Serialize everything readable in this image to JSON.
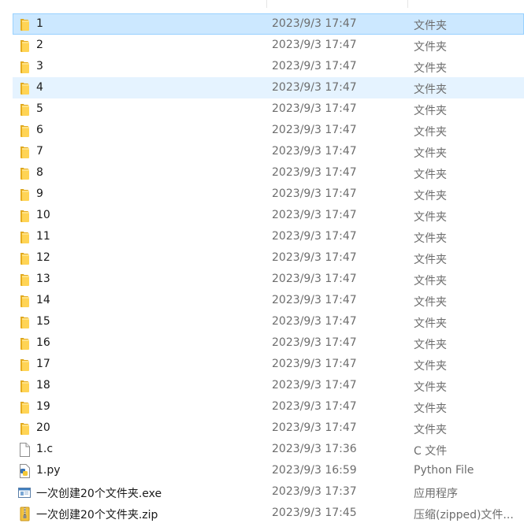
{
  "files": [
    {
      "name": "1",
      "date": "2023/9/3 17:47",
      "type": "文件夹",
      "icon": "folder-icon",
      "state": "selected"
    },
    {
      "name": "2",
      "date": "2023/9/3 17:47",
      "type": "文件夹",
      "icon": "folder-icon",
      "state": ""
    },
    {
      "name": "3",
      "date": "2023/9/3 17:47",
      "type": "文件夹",
      "icon": "folder-icon",
      "state": ""
    },
    {
      "name": "4",
      "date": "2023/9/3 17:47",
      "type": "文件夹",
      "icon": "folder-icon",
      "state": "hover"
    },
    {
      "name": "5",
      "date": "2023/9/3 17:47",
      "type": "文件夹",
      "icon": "folder-icon",
      "state": ""
    },
    {
      "name": "6",
      "date": "2023/9/3 17:47",
      "type": "文件夹",
      "icon": "folder-icon",
      "state": ""
    },
    {
      "name": "7",
      "date": "2023/9/3 17:47",
      "type": "文件夹",
      "icon": "folder-icon",
      "state": ""
    },
    {
      "name": "8",
      "date": "2023/9/3 17:47",
      "type": "文件夹",
      "icon": "folder-icon",
      "state": ""
    },
    {
      "name": "9",
      "date": "2023/9/3 17:47",
      "type": "文件夹",
      "icon": "folder-icon",
      "state": ""
    },
    {
      "name": "10",
      "date": "2023/9/3 17:47",
      "type": "文件夹",
      "icon": "folder-icon",
      "state": ""
    },
    {
      "name": "11",
      "date": "2023/9/3 17:47",
      "type": "文件夹",
      "icon": "folder-icon",
      "state": ""
    },
    {
      "name": "12",
      "date": "2023/9/3 17:47",
      "type": "文件夹",
      "icon": "folder-icon",
      "state": ""
    },
    {
      "name": "13",
      "date": "2023/9/3 17:47",
      "type": "文件夹",
      "icon": "folder-icon",
      "state": ""
    },
    {
      "name": "14",
      "date": "2023/9/3 17:47",
      "type": "文件夹",
      "icon": "folder-icon",
      "state": ""
    },
    {
      "name": "15",
      "date": "2023/9/3 17:47",
      "type": "文件夹",
      "icon": "folder-icon",
      "state": ""
    },
    {
      "name": "16",
      "date": "2023/9/3 17:47",
      "type": "文件夹",
      "icon": "folder-icon",
      "state": ""
    },
    {
      "name": "17",
      "date": "2023/9/3 17:47",
      "type": "文件夹",
      "icon": "folder-icon",
      "state": ""
    },
    {
      "name": "18",
      "date": "2023/9/3 17:47",
      "type": "文件夹",
      "icon": "folder-icon",
      "state": ""
    },
    {
      "name": "19",
      "date": "2023/9/3 17:47",
      "type": "文件夹",
      "icon": "folder-icon",
      "state": ""
    },
    {
      "name": "20",
      "date": "2023/9/3 17:47",
      "type": "文件夹",
      "icon": "folder-icon",
      "state": ""
    },
    {
      "name": "1.c",
      "date": "2023/9/3 17:36",
      "type": "C 文件",
      "icon": "c-file-icon",
      "state": ""
    },
    {
      "name": "1.py",
      "date": "2023/9/3 16:59",
      "type": "Python File",
      "icon": "python-file-icon",
      "state": ""
    },
    {
      "name": "一次创建20个文件夹.exe",
      "date": "2023/9/3 17:37",
      "type": "应用程序",
      "icon": "exe-file-icon",
      "state": ""
    },
    {
      "name": "一次创建20个文件夹.zip",
      "date": "2023/9/3 17:45",
      "type": "压缩(zipped)文件...",
      "icon": "zip-file-icon",
      "state": ""
    }
  ]
}
